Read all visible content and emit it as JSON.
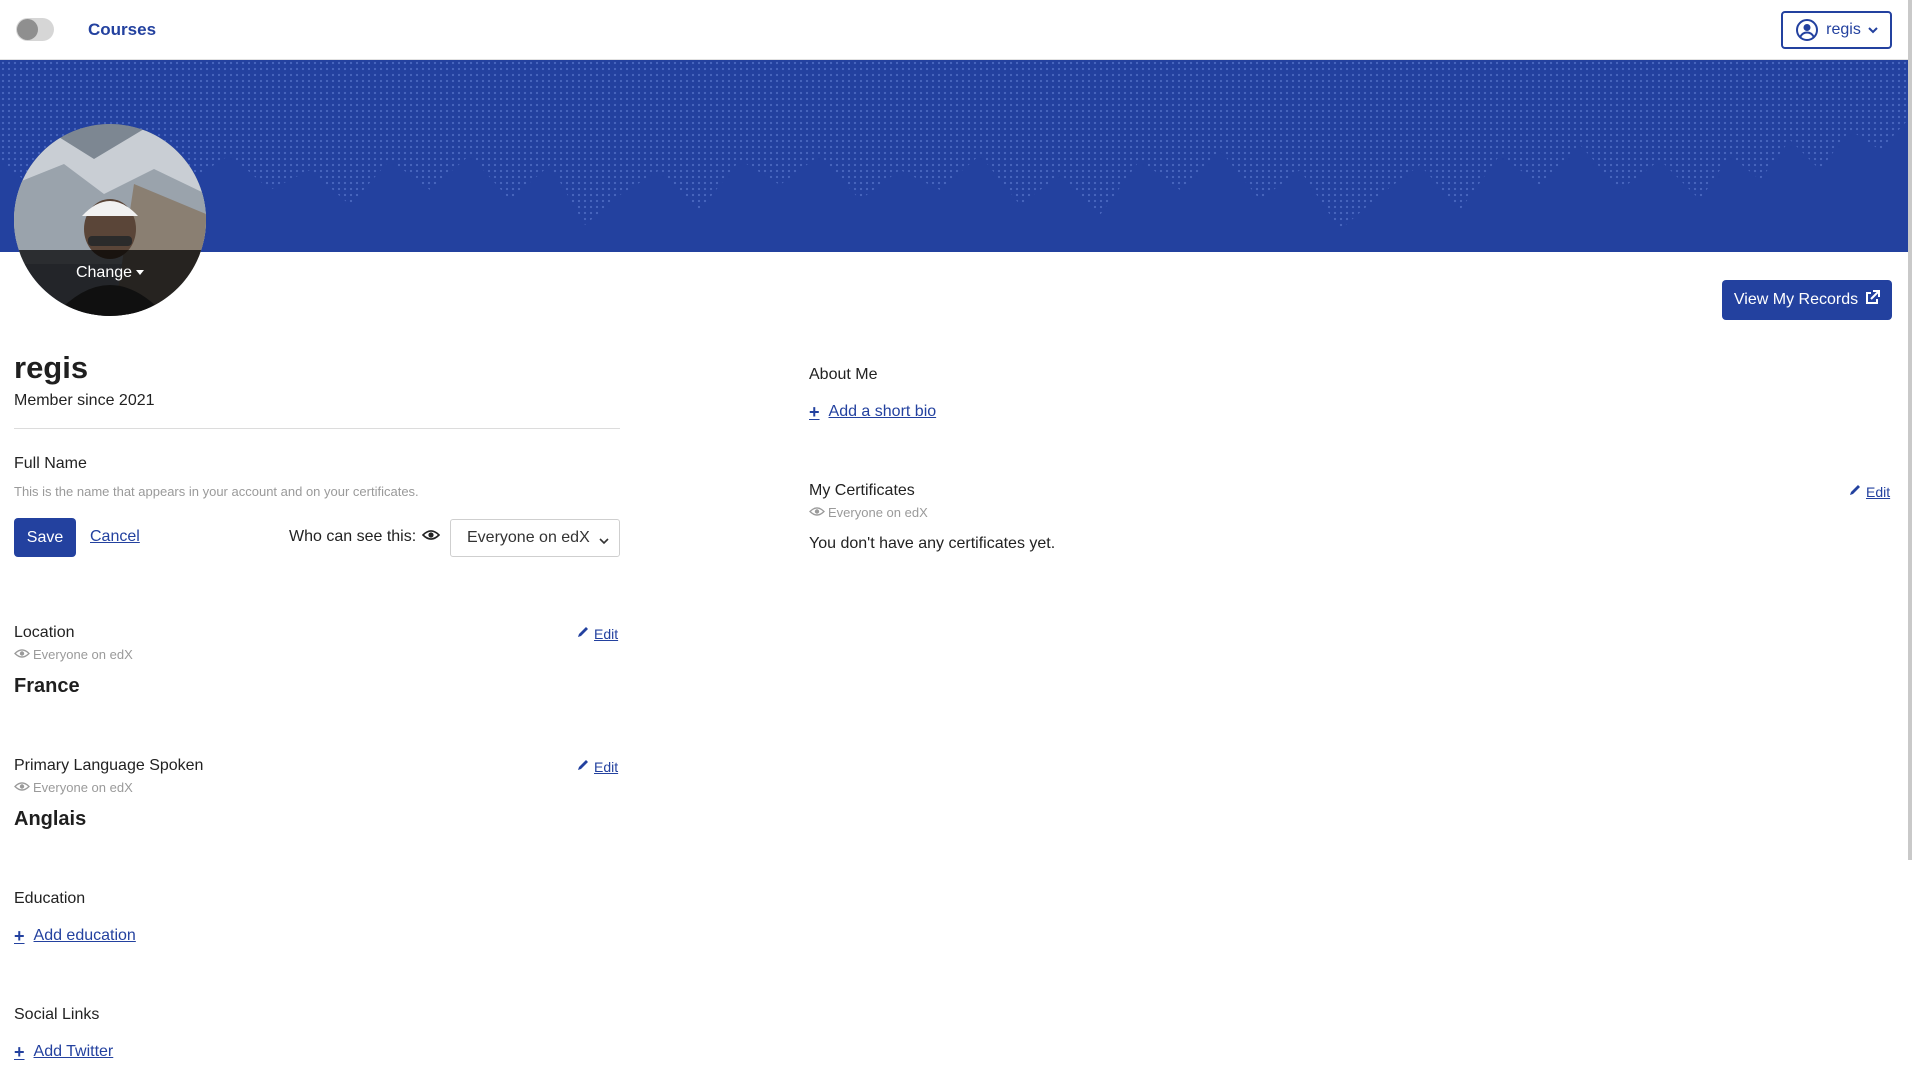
{
  "header": {
    "nav_courses": "Courses",
    "user_menu_label": "regis"
  },
  "profile": {
    "avatar_change_label": "Change",
    "view_records_label": "View My Records",
    "username": "regis",
    "member_since": "Member since 2021"
  },
  "full_name": {
    "label": "Full Name",
    "helper": "This is the name that appears in your account and on your certificates.",
    "save_label": "Save",
    "cancel_label": "Cancel",
    "who_can_see_label": "Who can see this:",
    "visibility_selected": "Everyone on edX"
  },
  "location": {
    "label": "Location",
    "visibility": "Everyone on edX",
    "value": "France",
    "edit_label": "Edit"
  },
  "language": {
    "label": "Primary Language Spoken",
    "visibility": "Everyone on edX",
    "value": "Anglais",
    "edit_label": "Edit"
  },
  "education": {
    "label": "Education",
    "add_label": "Add education"
  },
  "social_links": {
    "label": "Social Links",
    "add_label": "Add Twitter"
  },
  "about_me": {
    "label": "About Me",
    "add_label": "Add a short bio"
  },
  "certificates": {
    "label": "My Certificates",
    "visibility": "Everyone on edX",
    "edit_label": "Edit",
    "empty_text": "You don't have any certificates yet."
  },
  "colors": {
    "brand_blue": "#23419f",
    "muted_text": "#9a9a9a"
  }
}
